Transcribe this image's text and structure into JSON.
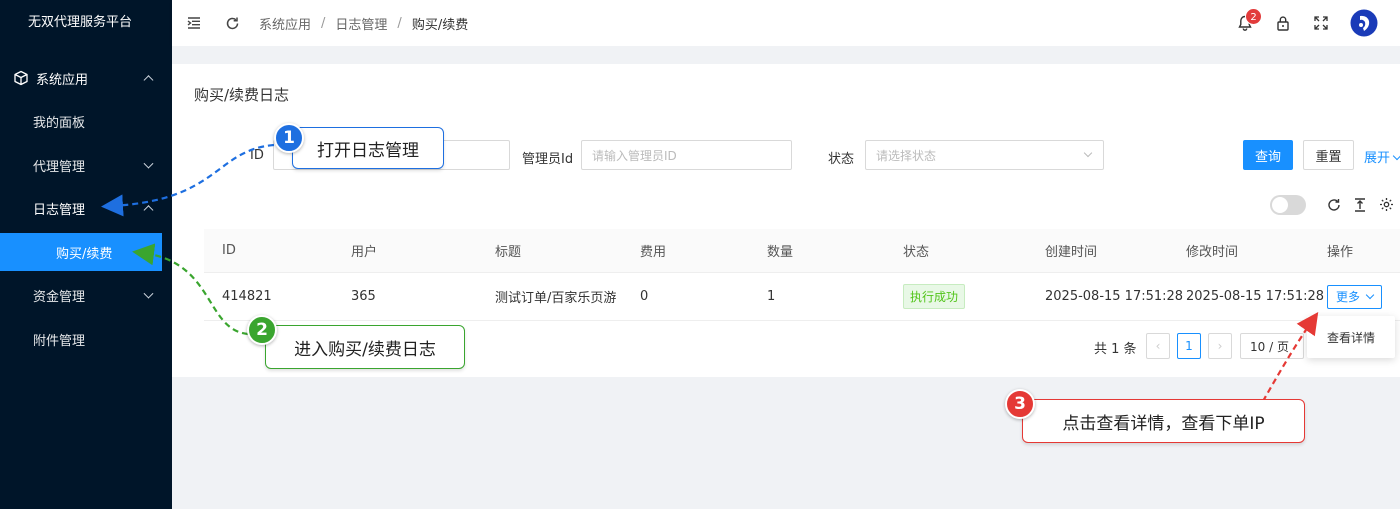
{
  "sidebar": {
    "brand": "无双代理服务平台",
    "group_system": "系统应用",
    "item_dashboard": "我的面板",
    "item_agent": "代理管理",
    "item_log": "日志管理",
    "item_purchase": "购买/续费",
    "item_funds": "资金管理",
    "item_attachment": "附件管理"
  },
  "header": {
    "breadcrumb": [
      "系统应用",
      "日志管理",
      "购买/续费"
    ],
    "separator": "/",
    "notification_count": "2"
  },
  "page": {
    "title": "购买/续费日志"
  },
  "filters": {
    "id_label": "ID",
    "admin_label": "管理员Id",
    "admin_placeholder": "请输入管理员ID",
    "status_label": "状态",
    "status_placeholder": "请选择状态",
    "query_button": "查询",
    "reset_button": "重置",
    "expand_link": "展开"
  },
  "table": {
    "columns": [
      "ID",
      "用户",
      "标题",
      "费用",
      "数量",
      "状态",
      "创建时间",
      "修改时间",
      "操作"
    ],
    "rows": [
      {
        "id": "414821",
        "user": "365",
        "title": "测试订单/百家乐页游",
        "fee": "0",
        "quantity": "1",
        "status": "执行成功",
        "created": "2025-08-15 17:51:28",
        "modified": "2025-08-15 17:51:28",
        "action": "更多"
      }
    ]
  },
  "pagination": {
    "total": "共 1 条",
    "current_page": "1",
    "page_size": "10 / 页"
  },
  "dropdown": {
    "item": "查看详情"
  },
  "callouts": [
    {
      "num": "1",
      "text": "打开日志管理",
      "color": "#1e6fe0"
    },
    {
      "num": "2",
      "text": "进入购买/续费日志",
      "color": "#3aa52f"
    },
    {
      "num": "3",
      "text": "点击查看详情，查看下单IP",
      "color": "#e53935"
    }
  ],
  "colors": {
    "sidebar_bg": "#001529",
    "primary": "#1890ff",
    "success": "#52c41a"
  }
}
